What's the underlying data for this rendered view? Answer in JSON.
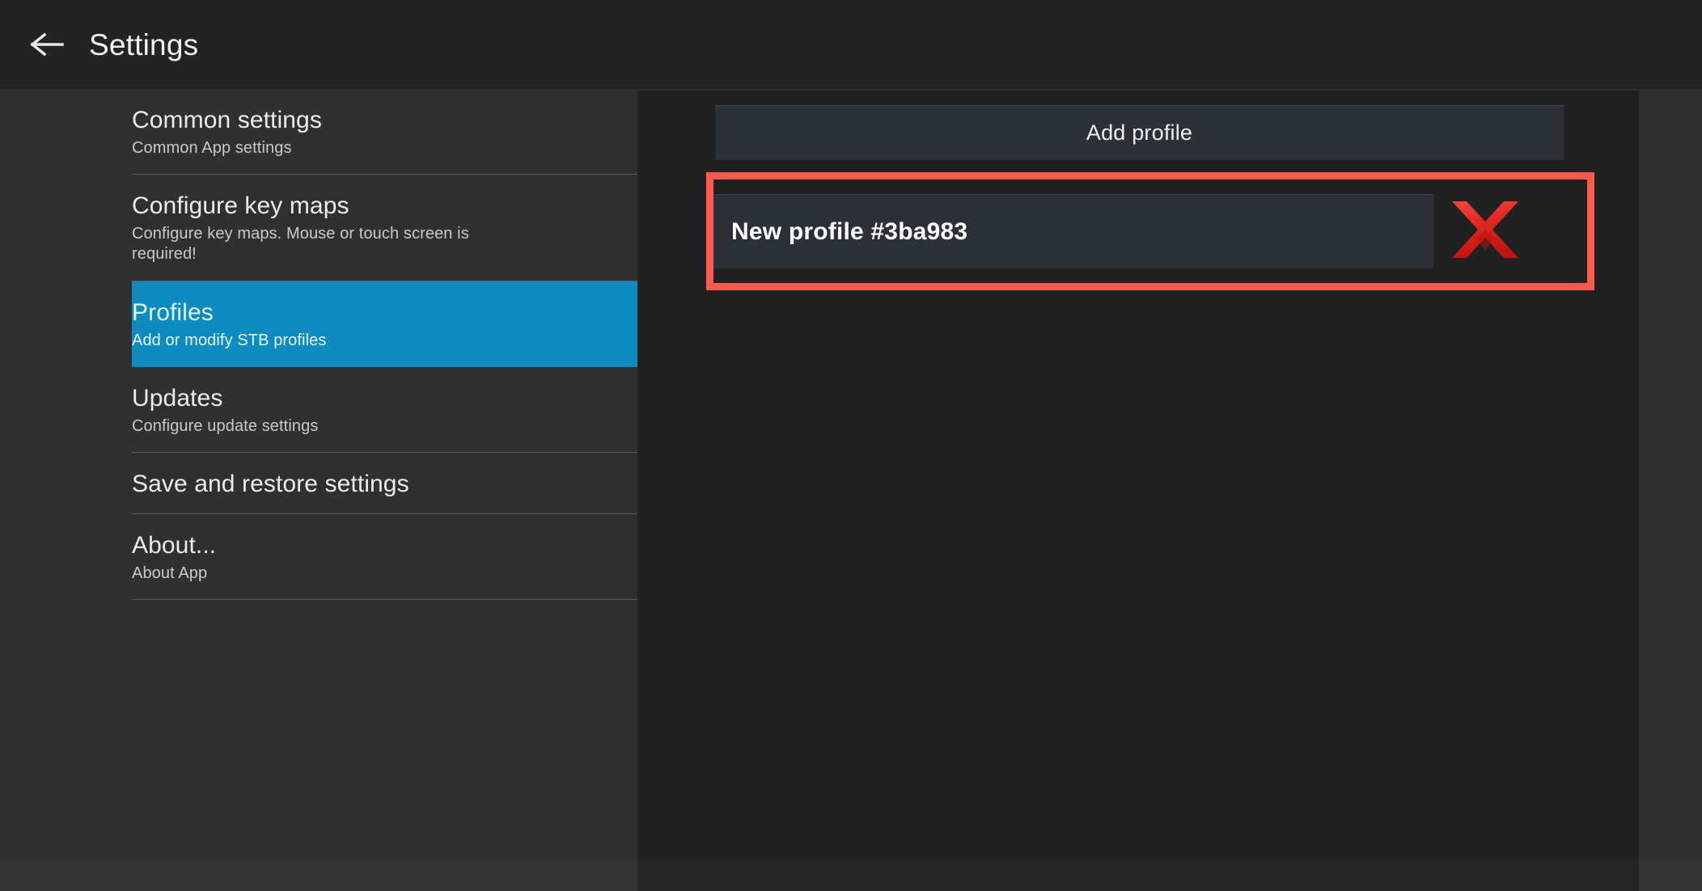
{
  "header": {
    "back_icon": "back-arrow-icon",
    "title": "Settings"
  },
  "sidebar": {
    "items": [
      {
        "title": "Common settings",
        "subtitle": "Common App settings",
        "selected": false
      },
      {
        "title": "Configure key maps",
        "subtitle": "Configure key maps. Mouse or touch screen is required!",
        "selected": false
      },
      {
        "title": "Profiles",
        "subtitle": "Add or modify STB profiles",
        "selected": true
      },
      {
        "title": "Updates",
        "subtitle": "Configure update settings",
        "selected": false
      },
      {
        "title": "Save and restore settings",
        "subtitle": "",
        "selected": false
      },
      {
        "title": "About...",
        "subtitle": "About App",
        "selected": false
      }
    ]
  },
  "main": {
    "add_profile_label": "Add profile",
    "profiles": [
      {
        "name": "New profile #3ba983",
        "delete_icon": "red-cross-delete-icon"
      }
    ]
  },
  "annotation": {
    "type": "highlight-box",
    "color": "#fb5a4c"
  },
  "colors": {
    "accent_blue": "#0e8cc0",
    "header_bg": "#232323",
    "sidebar_bg": "#303030",
    "panel_bg": "#212121",
    "field_bg": "#2b3136",
    "annotation_red": "#fb5a4c",
    "delete_icon_red": "#e02020"
  }
}
